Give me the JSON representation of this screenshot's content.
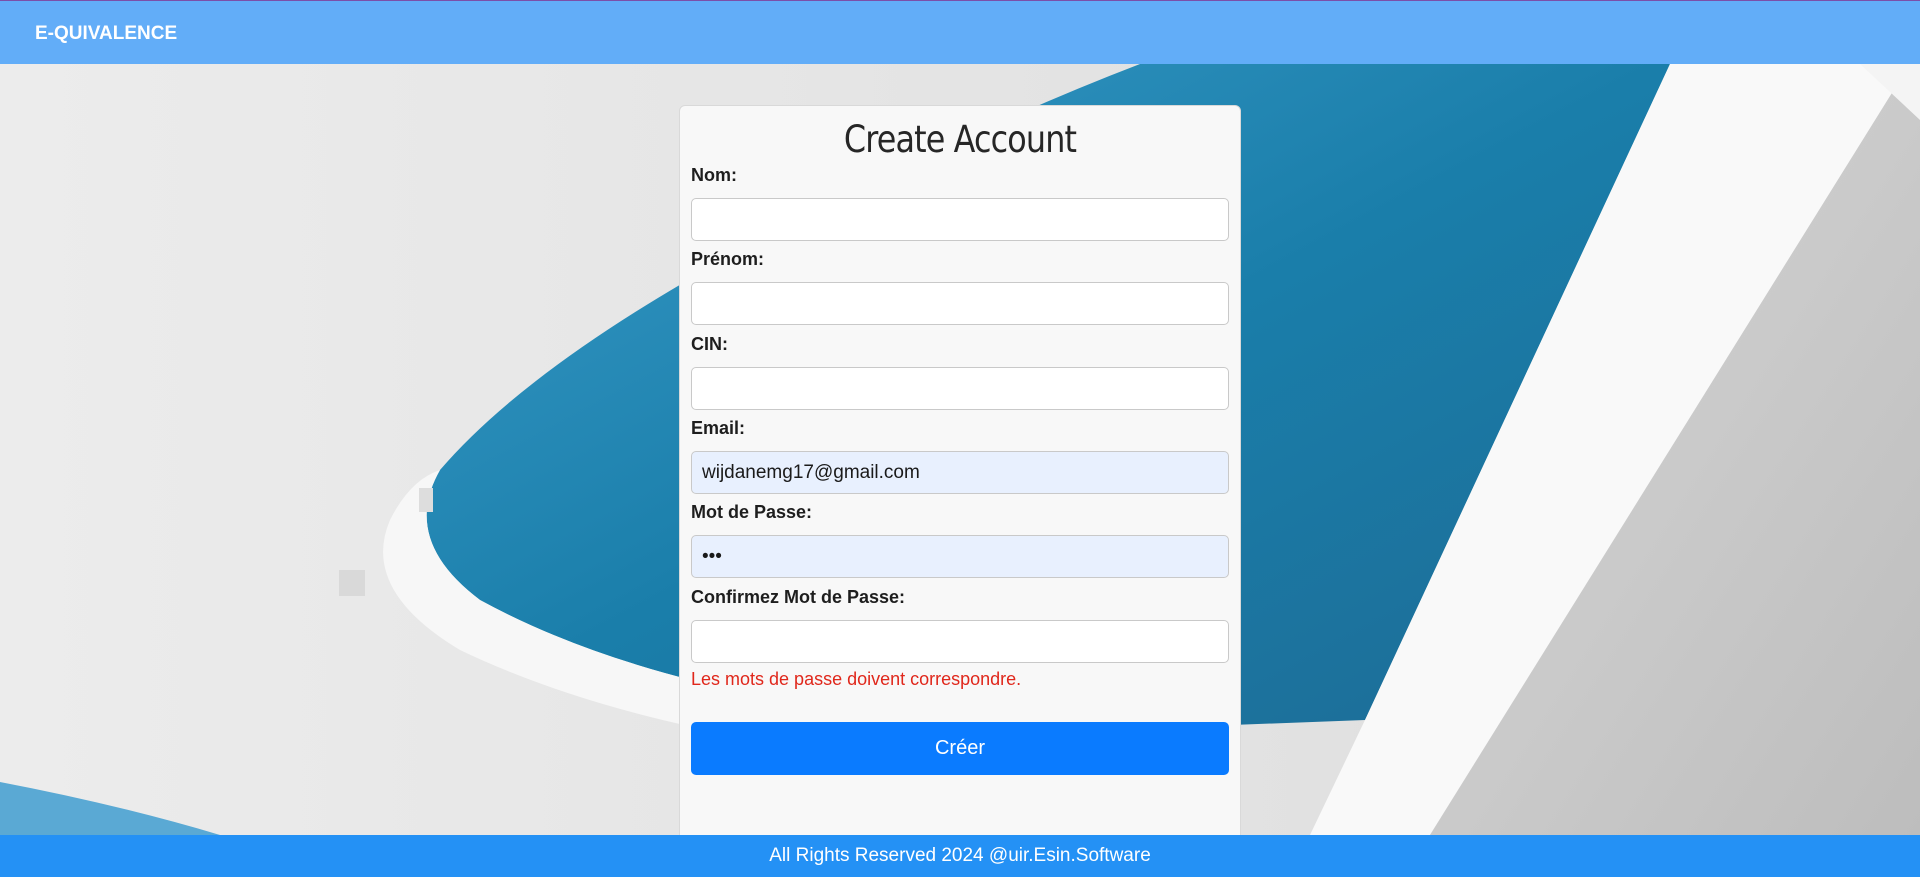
{
  "header": {
    "brand": "E-QUIVALENCE"
  },
  "form": {
    "title": "Create Account",
    "fields": [
      {
        "label": "Nom:",
        "value": ""
      },
      {
        "label": "Prénom:",
        "value": ""
      },
      {
        "label": "CIN:",
        "value": ""
      },
      {
        "label": "Email:",
        "value": "wijdanemg17@gmail.com"
      },
      {
        "label": "Mot de Passe:",
        "value": "•••"
      },
      {
        "label": "Confirmez Mot de Passe:",
        "value": ""
      }
    ],
    "error": "Les mots de passe doivent correspondre.",
    "submit_label": "Créer"
  },
  "footer": {
    "text": "All Rights Reserved 2024 @uir.Esin.Software"
  },
  "colors": {
    "header_bg": "#62adf8",
    "footer_bg": "#2491f5",
    "button_bg": "#0a7bff",
    "error": "#e0271b",
    "autofill_bg": "#e8f0fe"
  }
}
